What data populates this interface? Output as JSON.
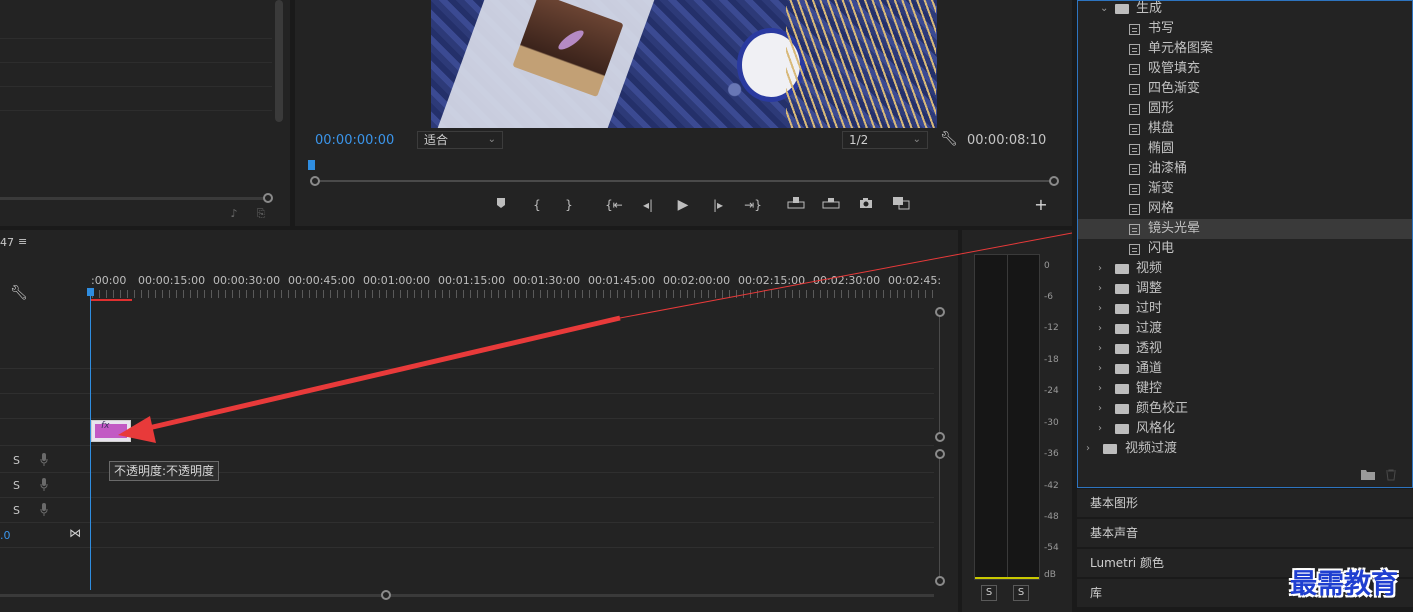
{
  "program_monitor": {
    "current_timecode": "00:00:00:00",
    "fit_label": "适合",
    "resolution_label": "1/2",
    "duration_timecode": "00:00:08:10"
  },
  "timeline": {
    "header_fragment": "47",
    "ruler_labels": [
      ":00:00",
      "00:00:15:00",
      "00:00:30:00",
      "00:00:45:00",
      "00:01:00:00",
      "00:01:15:00",
      "00:01:30:00",
      "00:01:45:00",
      "00:02:00:00",
      "00:02:15:00",
      "00:02:30:00",
      "00:02:45:"
    ],
    "clip_fx_label": "fx",
    "tooltip": "不透明度:不透明度",
    "track_solo": [
      "S",
      "S",
      "S"
    ],
    "volume_fragment": ".0"
  },
  "audio_meter": {
    "scale": [
      "0",
      "-6",
      "-12",
      "-18",
      "-24",
      "-30",
      "-36",
      "-42",
      "-48",
      "-54",
      "dB"
    ],
    "solo_buttons": [
      "S",
      "S"
    ],
    "peak_color": "#c8c800"
  },
  "effects_panel": {
    "group_open": "生成",
    "items": [
      "书写",
      "单元格图案",
      "吸管填充",
      "四色渐变",
      "圆形",
      "棋盘",
      "椭圆",
      "油漆桶",
      "渐变",
      "网格",
      "镜头光晕",
      "闪电"
    ],
    "selected_item": "镜头光晕",
    "groups_collapsed": [
      "视频",
      "调整",
      "过时",
      "过渡",
      "透视",
      "通道",
      "键控",
      "颜色校正",
      "风格化"
    ],
    "top_level": "视频过渡"
  },
  "side_panels": [
    "基本图形",
    "基本声音",
    "Lumetri 颜色",
    "库"
  ],
  "watermark": "最需教育",
  "colors": {
    "accent_blue": "#3b95ea",
    "annotation_arrow": "#e83a3a",
    "panel_bg": "#232323",
    "in_out_bar": "#e03030"
  }
}
